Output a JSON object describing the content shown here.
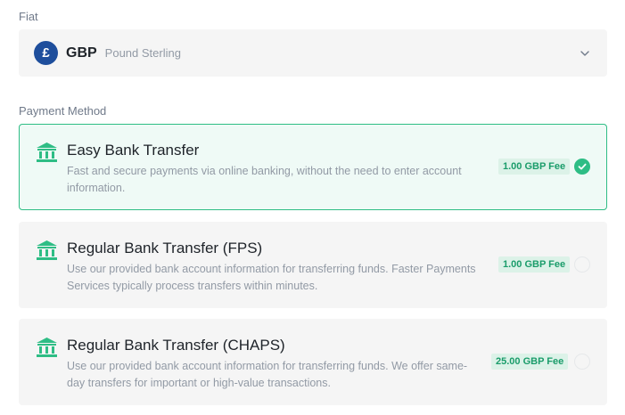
{
  "fiat": {
    "label": "Fiat",
    "selected": {
      "symbol": "£",
      "code": "GBP",
      "name": "Pound Sterling"
    },
    "chevron_icon": "chevron-down-icon"
  },
  "payment_method": {
    "label": "Payment Method",
    "options": [
      {
        "title": "Easy Bank Transfer",
        "description": "Fast and secure payments via online banking, without the need to enter account information.",
        "fee": "1.00 GBP Fee",
        "selected": true,
        "icon": "bank-icon"
      },
      {
        "title": "Regular Bank Transfer (FPS)",
        "description": "Use our provided bank account information for transferring funds. Faster Payments Services typically process transfers within minutes.",
        "fee": "1.00 GBP Fee",
        "selected": false,
        "icon": "bank-icon"
      },
      {
        "title": "Regular Bank Transfer (CHAPS)",
        "description": "Use our provided bank account information for transferring funds. We offer same-day transfers for important or high-value transactions.",
        "fee": "25.00 GBP Fee",
        "selected": false,
        "icon": "bank-icon"
      }
    ]
  },
  "colors": {
    "accent": "#2ebd85",
    "selected_bg": "#effaf6",
    "card_bg": "#f5f5f5",
    "currency_badge": "#1e4e9c"
  }
}
